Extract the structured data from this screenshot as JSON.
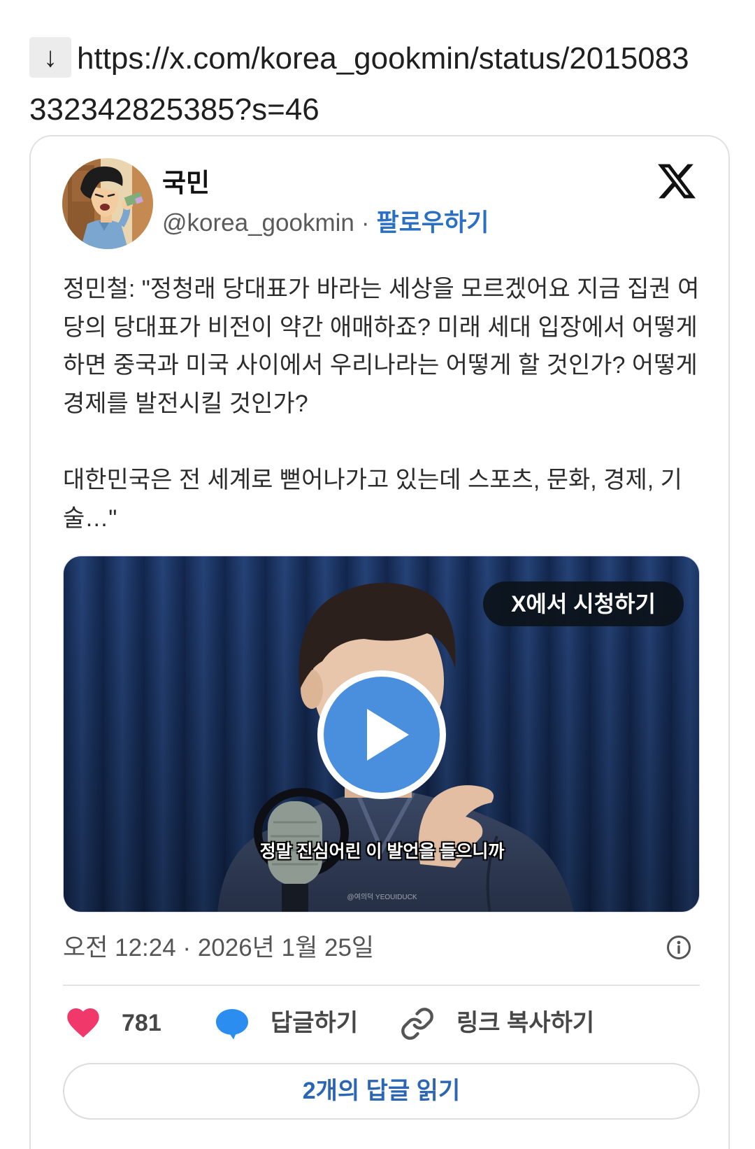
{
  "header": {
    "download_icon": "download-arrow-icon",
    "arrow_glyph": "↓",
    "url": "https://x.com/korea_gookmin/status/2015083332342825385?s=46"
  },
  "tweet": {
    "author": {
      "avatar": "cartoon-character-avatar",
      "name": "국민",
      "handle": "@korea_gookmin",
      "separator": "·",
      "follow_label": "팔로우하기"
    },
    "platform_logo": "x-logo-icon",
    "text": {
      "paragraph1": "정민철: \"정청래 당대표가 바라는 세상을 모르겠어요 지금 집권 여당의 당대표가 비전이 약간 애매하죠? 미래 세대 입장에서 어떻게 하면 중국과 미국 사이에서 우리나라는 어떻게 할 것인가? 어떻게 경제를 발전시킬 것인가?",
      "paragraph2": "대한민국은 전 세계로 뻗어나가고 있는데 스포츠, 문화, 경제, 기술…\""
    },
    "video": {
      "watch_label": "X에서 시청하기",
      "play_icon": "play-icon",
      "subtitle": "정말 진심어린 이 발언을 들으니까",
      "watermark": "@여의덕 YEOUIDUCK"
    },
    "timestamp": "오전 12:24 · 2026년 1월 25일",
    "info_icon": "info-icon",
    "actions": {
      "like_icon": "heart-icon",
      "likes": "781",
      "reply_icon": "speech-bubble-icon",
      "reply_label": "답글하기",
      "link_icon": "link-icon",
      "copy_link_label": "링크 복사하기"
    },
    "read_replies_label": "2개의 답글 읽기"
  },
  "colors": {
    "accent_blue": "#2a6fc2",
    "like_pink": "#f0386b",
    "reply_blue": "#2b8df0",
    "play_blue": "#4a8fde",
    "secondary_text": "#555555"
  }
}
